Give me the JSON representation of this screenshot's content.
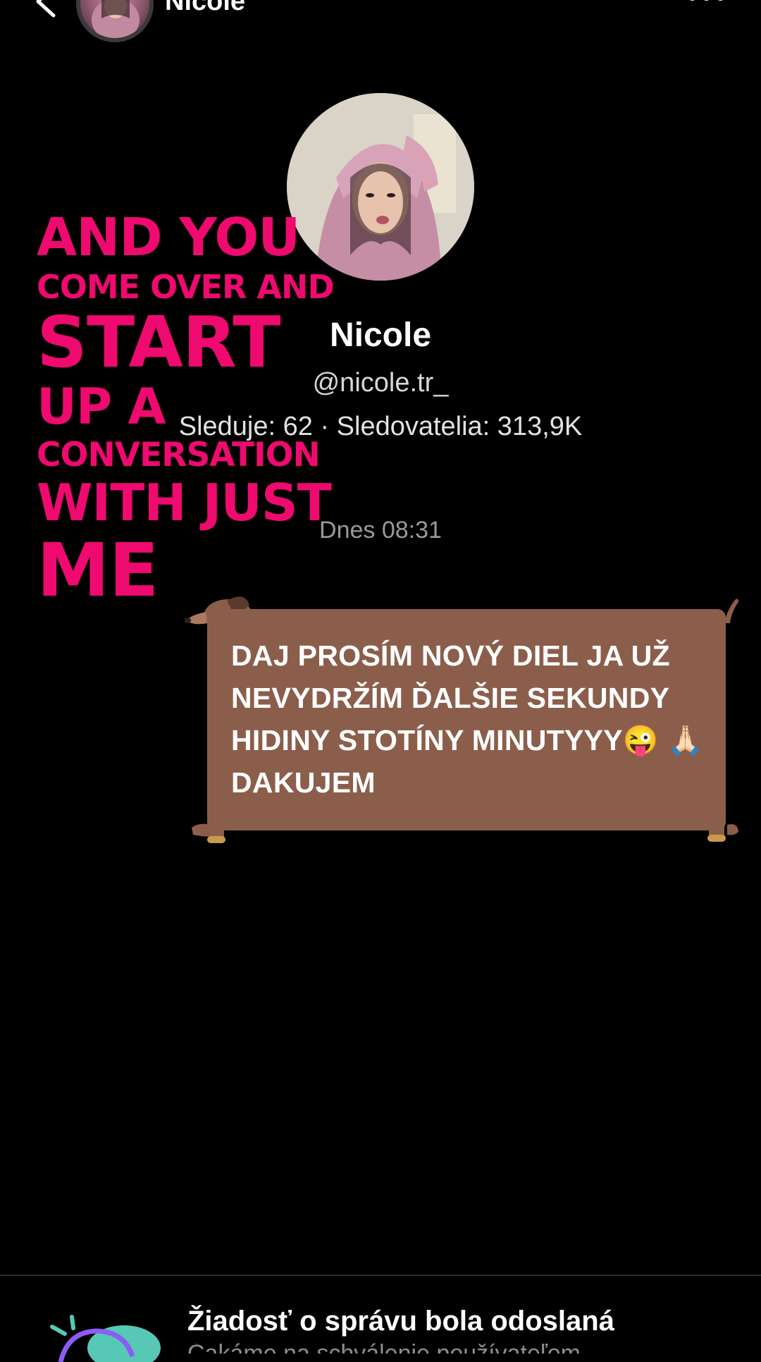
{
  "header": {
    "title": "Nicole",
    "back_icon": "chevron-left-icon",
    "more_icon": "more-horizontal-icon"
  },
  "sticker": {
    "lines": [
      "AND YOU",
      "COME OVER AND",
      "START",
      "UP A",
      "CONVERSATION",
      "WITH JUST",
      "ME"
    ],
    "color": "#ee0a6f"
  },
  "profile": {
    "name": "Nicole",
    "handle": "@nicole.tr_",
    "stats": "Sleduje: 62 · Sledovatelia: 313,9K"
  },
  "conversation": {
    "timestamp": "Dnes 08:31",
    "message": "DAJ PROSÍM NOVÝ DIEL JA UŽ NEVYDRŽÍM ĎALŠIE SEKUNDY HIDINY STOTÍNY MINUTYYY😜 🙏🏻 DAKUJEM",
    "bubble_color": "#8b5e4b"
  },
  "request_banner": {
    "title": "Žiadosť o správu bola odoslaná",
    "subtitle": "Čakáme na schválenie používateľom"
  }
}
